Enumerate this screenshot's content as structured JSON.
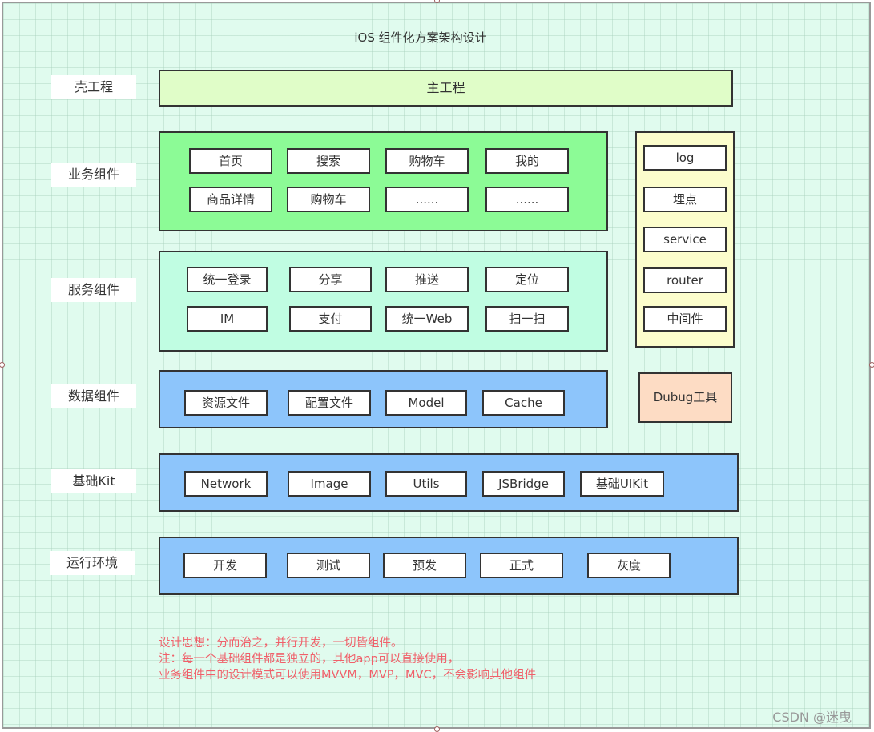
{
  "diagram": {
    "title": "iOS 组件化方案架构设计",
    "layers": {
      "shell": {
        "label": "壳工程",
        "main": "主工程"
      },
      "business": {
        "label": "业务组件",
        "items": [
          "首页",
          "搜索",
          "购物车",
          "我的",
          "商品详情",
          "购物车",
          "......",
          "......"
        ]
      },
      "service": {
        "label": "服务组件",
        "items": [
          "统一登录",
          "分享",
          "推送",
          "定位",
          "IM",
          "支付",
          "统一Web",
          "扫一扫"
        ]
      },
      "data": {
        "label": "数据组件",
        "items": [
          "资源文件",
          "配置文件",
          "Model",
          "Cache"
        ]
      },
      "basekit": {
        "label": "基础Kit",
        "items": [
          "Network",
          "Image",
          "Utils",
          "JSBridge",
          "基础UIKit"
        ]
      },
      "runtime": {
        "label": "运行环境",
        "items": [
          "开发",
          "测试",
          "预发",
          "正式",
          "灰度"
        ]
      }
    },
    "side_column": {
      "items": [
        "log",
        "埋点",
        "service",
        "router",
        "中间件"
      ]
    },
    "debug_tool": "Dubug工具",
    "notes": [
      "设计思想：分而治之，并行开发，一切皆组件。",
      "注：每一个基础组件都是独立的，其他app可以直接使用，",
      "业务组件中的设计模式可以使用MVVM，MVP，MVC，不会影响其他组件"
    ],
    "colors": {
      "background": "#e0fbee",
      "shell_fill": "#e0fdc8",
      "business_fill": "#8cfb96",
      "service_fill": "#c0fde2",
      "blue_fill": "#8dc5fb",
      "side_fill": "#fcfdcc",
      "debug_fill": "#fddcc4",
      "note_text": "#f0606a"
    }
  },
  "watermark": "CSDN @迷曳"
}
